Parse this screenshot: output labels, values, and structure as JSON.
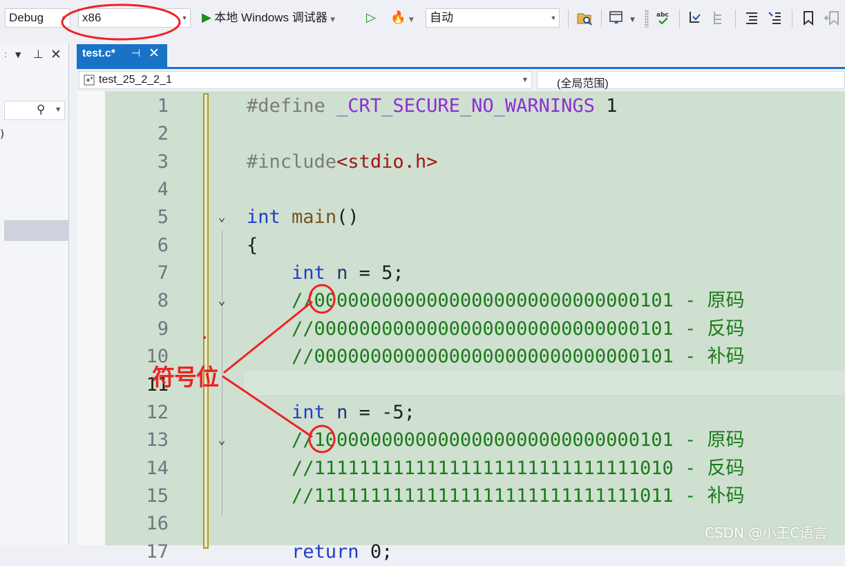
{
  "toolbar": {
    "config": "Debug",
    "platform": "x86",
    "debugger_label": "本地 Windows 调试器",
    "target_mode": "自动"
  },
  "tab": {
    "title": "test.c*",
    "pin_glyph": "⊣",
    "close_glyph": "✕"
  },
  "navbar": {
    "scope_file": "test_25_2_2_1",
    "scope_global": "(全局范围)"
  },
  "editor": {
    "lines": [
      {
        "n": "1",
        "parts": [
          [
            "pp",
            "#define "
          ],
          [
            "macro",
            "_CRT_SECURE_NO_WARNINGS"
          ],
          [
            "",
            " 1"
          ]
        ]
      },
      {
        "n": "2",
        "parts": []
      },
      {
        "n": "3",
        "parts": [
          [
            "pp",
            "#include"
          ],
          [
            "str",
            "<stdio.h>"
          ]
        ]
      },
      {
        "n": "4",
        "parts": []
      },
      {
        "n": "5",
        "parts": [
          [
            "kw",
            "int"
          ],
          [
            "",
            " "
          ],
          [
            "fn",
            "main"
          ],
          [
            "",
            "()"
          ]
        ],
        "fold": true
      },
      {
        "n": "6",
        "parts": [
          [
            "",
            "{"
          ]
        ]
      },
      {
        "n": "7",
        "parts": [
          [
            "",
            "    "
          ],
          [
            "kw",
            "int"
          ],
          [
            "",
            " "
          ],
          [
            "var",
            "n"
          ],
          [
            "",
            " = 5;"
          ]
        ]
      },
      {
        "n": "8",
        "parts": [
          [
            "",
            "    "
          ],
          [
            "cm",
            "//00000000000000000000000000000101 - 原码"
          ]
        ],
        "fold": true
      },
      {
        "n": "9",
        "parts": [
          [
            "",
            "    "
          ],
          [
            "cm",
            "//00000000000000000000000000000101 - 反码"
          ]
        ]
      },
      {
        "n": "10",
        "parts": [
          [
            "",
            "    "
          ],
          [
            "cm",
            "//00000000000000000000000000000101 - 补码"
          ]
        ]
      },
      {
        "n": "11",
        "parts": [],
        "current": true
      },
      {
        "n": "12",
        "parts": [
          [
            "",
            "    "
          ],
          [
            "kw",
            "int"
          ],
          [
            "",
            " "
          ],
          [
            "var",
            "n"
          ],
          [
            "",
            " = -5;"
          ]
        ]
      },
      {
        "n": "13",
        "parts": [
          [
            "",
            "    "
          ],
          [
            "cm",
            "//10000000000000000000000000000101 - 原码"
          ]
        ],
        "fold": true
      },
      {
        "n": "14",
        "parts": [
          [
            "",
            "    "
          ],
          [
            "cm",
            "//11111111111111111111111111111010 - 反码"
          ]
        ]
      },
      {
        "n": "15",
        "parts": [
          [
            "",
            "    "
          ],
          [
            "cm",
            "//11111111111111111111111111111011 - 补码"
          ]
        ]
      },
      {
        "n": "16",
        "parts": []
      },
      {
        "n": "17",
        "parts": [
          [
            "",
            "    "
          ],
          [
            "kw",
            "return"
          ],
          [
            "",
            " 0;"
          ]
        ]
      }
    ]
  },
  "annotation": {
    "label": "符号位",
    "color": "#ee2222"
  },
  "watermark": "CSDN @小王C语言",
  "colors": {
    "accent": "#1a72c7",
    "code_background": "#cfe0d0",
    "comment": "#1a7a1a",
    "keyword": "#1f3cc8"
  }
}
